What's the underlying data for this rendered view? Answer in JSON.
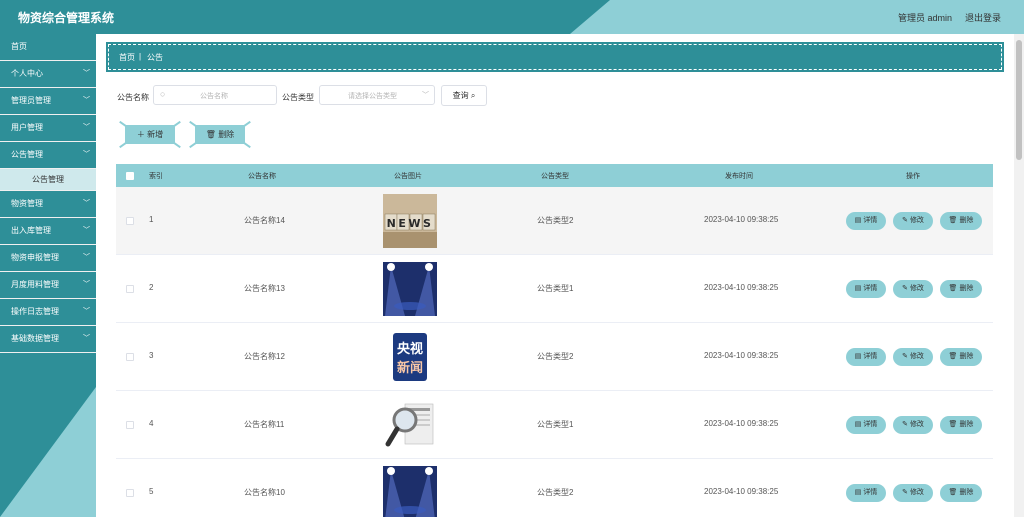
{
  "header": {
    "title": "物资综合管理系统",
    "user": "管理员 admin",
    "logout": "退出登录"
  },
  "sidebar": {
    "items": [
      {
        "label": "首页"
      },
      {
        "label": "个人中心"
      },
      {
        "label": "管理员管理"
      },
      {
        "label": "用户管理"
      },
      {
        "label": "公告管理"
      },
      {
        "label": "公告管理"
      },
      {
        "label": "物资管理"
      },
      {
        "label": "出入库管理"
      },
      {
        "label": "物资申报管理"
      },
      {
        "label": "月度用料管理"
      },
      {
        "label": "操作日志管理"
      },
      {
        "label": "基础数据管理"
      }
    ]
  },
  "breadcrumb": {
    "home": "首页",
    "sep": "|",
    "current": "公告"
  },
  "search": {
    "name_label": "公告名称",
    "name_placeholder": "公告名称",
    "type_label": "公告类型",
    "type_placeholder": "请选择公告类型",
    "query": "查询"
  },
  "actions": {
    "add": "新增",
    "delete": "删除"
  },
  "table": {
    "headers": [
      "索引",
      "公告名称",
      "公告图片",
      "公告类型",
      "发布时间",
      "操作"
    ],
    "rows": [
      {
        "index": "1",
        "name": "公告名称14",
        "type": "公告类型2",
        "time": "2023-04-10 09:38:25",
        "image": "news-dice"
      },
      {
        "index": "2",
        "name": "公告名称13",
        "type": "公告类型1",
        "time": "2023-04-10 09:38:25",
        "image": "stage-lights"
      },
      {
        "index": "3",
        "name": "公告名称12",
        "type": "公告类型2",
        "time": "2023-04-10 09:38:25",
        "image": "cctv-news-logo"
      },
      {
        "index": "4",
        "name": "公告名称11",
        "type": "公告类型1",
        "time": "2023-04-10 09:38:25",
        "image": "magnifier-newspaper"
      },
      {
        "index": "5",
        "name": "公告名称10",
        "type": "公告类型2",
        "time": "2023-04-10 09:38:25",
        "image": "stage-lights"
      }
    ],
    "ops": {
      "detail": "详情",
      "edit": "修改",
      "delete": "删除"
    }
  },
  "images": {
    "logo_line1": "央视",
    "logo_line2": "新闻",
    "news_word": "NEWS"
  },
  "colors": {
    "primary_dark": "#2e8f98",
    "primary_light": "#8ecfd6"
  }
}
